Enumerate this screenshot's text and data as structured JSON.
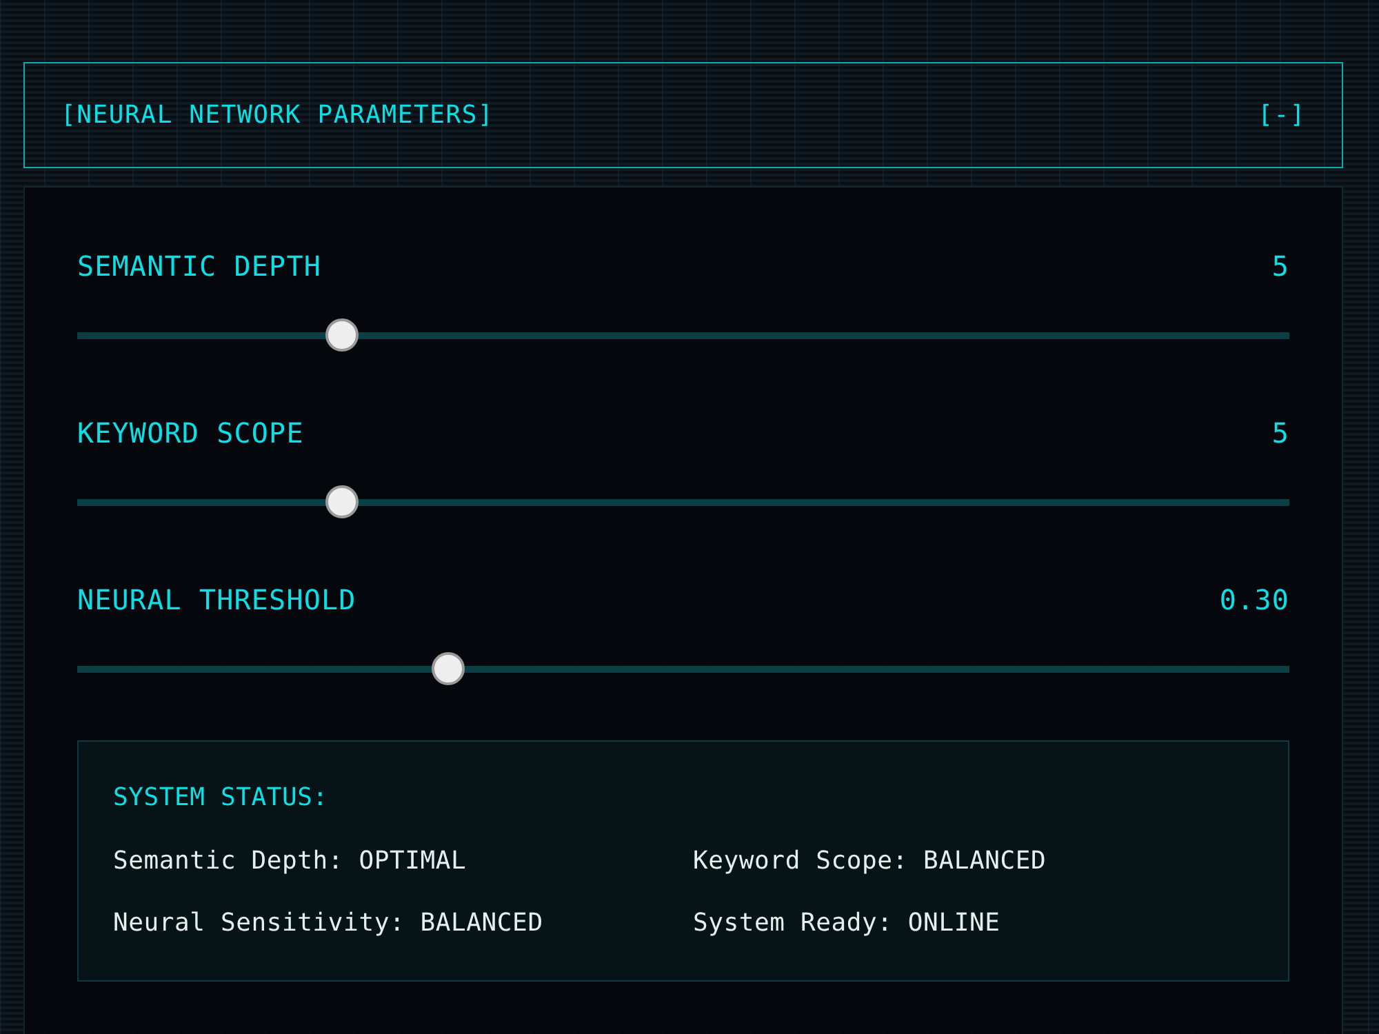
{
  "header": {
    "title": "[NEURAL NETWORK PARAMETERS]",
    "toggle": "[-]"
  },
  "sliders": [
    {
      "label": "SEMANTIC DEPTH",
      "reading": "5",
      "level": 0.21
    },
    {
      "label": "KEYWORD SCOPE",
      "reading": "5",
      "level": 0.21
    },
    {
      "label": "NEURAL THRESHOLD",
      "reading": "0.30",
      "level": 0.3
    }
  ],
  "status": {
    "title": "SYSTEM STATUS:",
    "items": [
      "Semantic Depth: OPTIMAL",
      "Keyword Scope: BALANCED",
      "Neural Sensitivity: BALANCED",
      "System Ready: ONLINE"
    ]
  }
}
